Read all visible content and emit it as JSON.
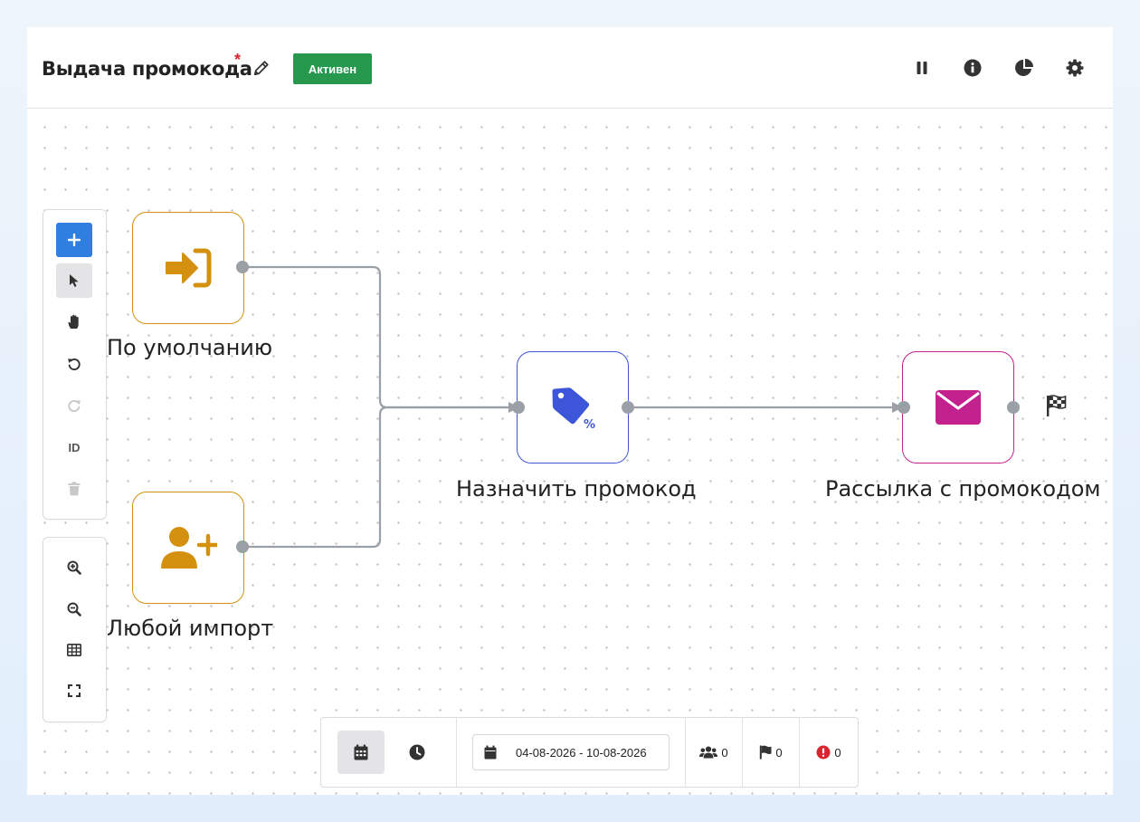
{
  "header": {
    "title": "Выдача промокода",
    "required_mark": "*",
    "status_badge": "Активен",
    "actions": [
      "pause-icon",
      "info-icon",
      "chart-pie-icon",
      "gear-icon"
    ]
  },
  "toolbar": {
    "tools": [
      "plus-icon",
      "cursor-icon",
      "hand-icon",
      "undo-icon",
      "redo-icon",
      "ID",
      "trash-icon"
    ],
    "id_label": "ID",
    "zoom_tools": [
      "zoom-in-icon",
      "zoom-out-icon",
      "grid-icon",
      "fit-screen-icon"
    ]
  },
  "nodes": [
    {
      "label": "По умолчанию",
      "icon": "sign-in-icon",
      "color": "#d4900f"
    },
    {
      "label": "Любой импорт",
      "icon": "user-plus-icon",
      "color": "#d4900f"
    },
    {
      "label": "Назначить промокод",
      "icon": "tag-percent-icon",
      "color": "#3d55d8"
    },
    {
      "label": "Рассылка с промокодом",
      "icon": "envelope-icon",
      "color": "#c3218e"
    }
  ],
  "end_marker": "finish-flag-icon",
  "bottom_bar": {
    "modes": [
      "calendar-icon",
      "clock-icon"
    ],
    "date_range": "04-08-2026 - 10-08-2026",
    "users_count": "0",
    "flags_count": "0",
    "errors_count": "0"
  },
  "colors": {
    "badge_green": "#27994f",
    "primary_blue": "#2f7fe0",
    "connector_gray": "#9aa0a6",
    "error_red": "#d9262e"
  }
}
